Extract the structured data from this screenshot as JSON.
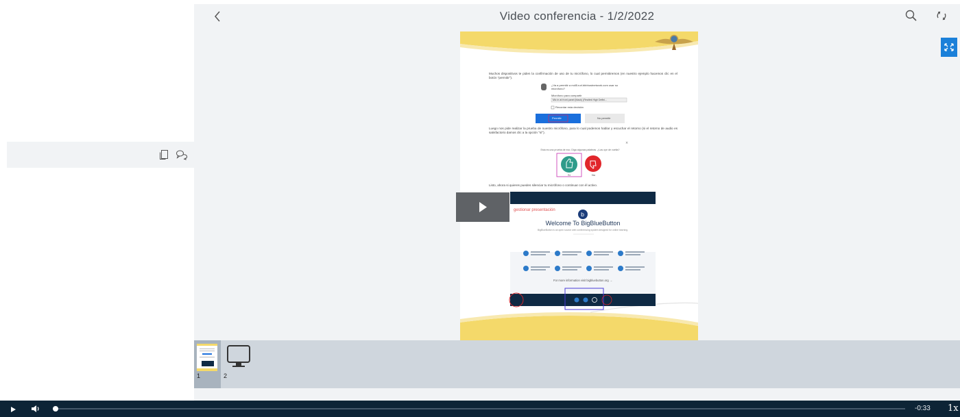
{
  "header": {
    "title": "Video conferencia - 1/2/2022"
  },
  "slide": {
    "paragraph_1": "Muchos dispositivos te piden la confirmación de uso de tu micrófono, lo cual permitiremos (en nuestro ejemplo hacemos clic en el botón \"permitir\").",
    "mic_prompt": "¿Va a permitir a mdl5.rurl.bbbhostnetwork.com usar su micrófono?",
    "mic_share_label": "Micrófono para compartir",
    "mic_device": "Mic in at front panel (black) (Realtek High Defini...",
    "remember_label": "Recordar esta decisión",
    "allow_button": "Permitir",
    "deny_button": "No permitir",
    "paragraph_2": "Luego nos pide realizar la prueba de nuestro micrófono, para lo cual podemos hablar y escuchar el retorno (si el retorno de audio es satisfactorio damos clic a la opción \"sí\").",
    "echo_question": "Esta es una prueba de eco. Diga algunas palabras. ¿Las oye de vuelta?",
    "yes_label": "Sí",
    "no_label": "No",
    "paragraph_3": "Listo, ahora si quieres puedes silenciar tu micrófono o continuar con él activo.",
    "gestionar_label": "gestionar presentación",
    "welcome_title": "Welcome To BigBlueButton",
    "welcome_sub": "BigBlueButton is an open source web conferencing system designed for online learning.",
    "more_info": "For more information visit bigbluebutton.org →"
  },
  "thumbnails": [
    {
      "label": "1"
    },
    {
      "label": "2"
    }
  ],
  "player": {
    "time": "-0:33",
    "speed": "1x",
    "progress": 0.002
  },
  "colors": {
    "accent": "#1b80d9",
    "player_bg": "#0d2436",
    "strip_bg": "#cfd6dd",
    "main_bg": "#f1f3f5"
  },
  "icons": {
    "back": "chevron-left-icon",
    "search": "search-icon",
    "sync": "sync-icon",
    "fullscreen": "fullscreen-icon",
    "notes": "notes-icon",
    "chat": "chat-icon",
    "play": "play-icon",
    "volume": "volume-icon",
    "screen": "monitor-icon"
  }
}
